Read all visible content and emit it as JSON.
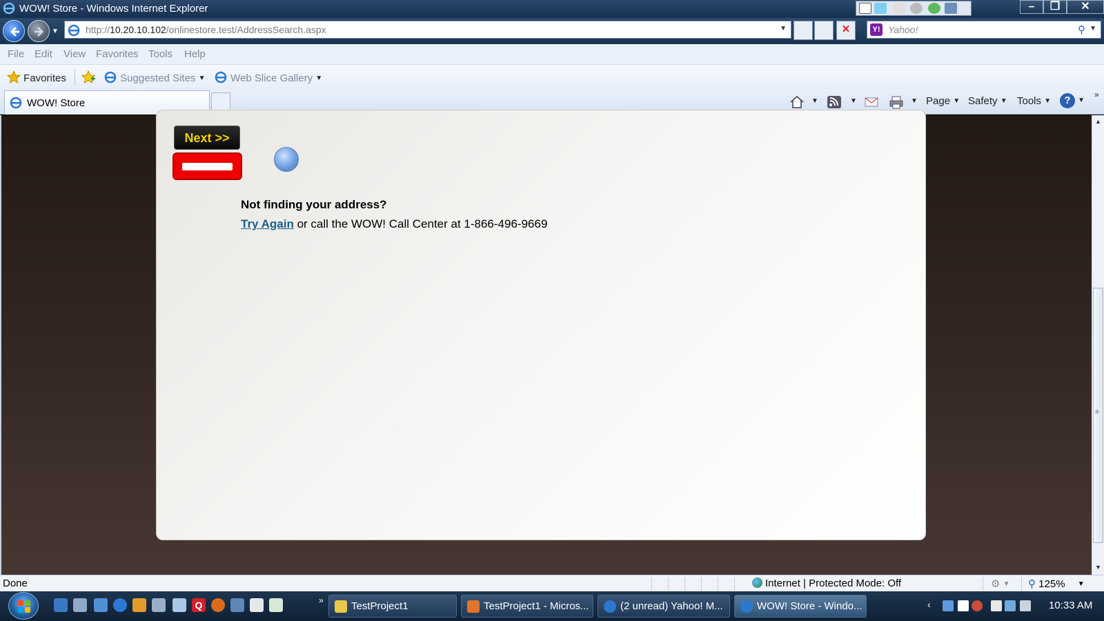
{
  "window": {
    "title": "WOW! Store - Windows Internet Explorer"
  },
  "address_bar": {
    "url_prefix": "http://",
    "url_host": "10.20.10.102",
    "url_path": "/onlinestore.test/AddressSearch.aspx"
  },
  "search": {
    "placeholder": "Yahoo!",
    "logo_letter": "Y!"
  },
  "menu": [
    "File",
    "Edit",
    "View",
    "Favorites",
    "Tools",
    "Help"
  ],
  "favorites_bar": {
    "favorites_label": "Favorites",
    "suggested_label": "Suggested Sites",
    "webslice_label": "Web Slice Gallery"
  },
  "tabs": [
    {
      "label": "WOW! Store"
    }
  ],
  "command_bar": {
    "page_label": "Page",
    "safety_label": "Safety",
    "tools_label": "Tools",
    "help_label": "?"
  },
  "page": {
    "next_button": "Next >>",
    "not_finding": "Not finding your address?",
    "try_again": "Try Again",
    "call_text": " or call the WOW! Call Center at 1-866-496-9669"
  },
  "status_bar": {
    "status": "Done",
    "zone": "Internet | Protected Mode: Off",
    "zoom": "125%"
  },
  "taskbar": {
    "tasks": [
      {
        "label": "TestProject1"
      },
      {
        "label": "TestProject1 - Micros..."
      },
      {
        "label": "(2 unread) Yahoo! M..."
      },
      {
        "label": "WOW! Store - Windo..."
      }
    ],
    "clock": "10:33 AM"
  },
  "colors": {
    "next_text": "#f5d200",
    "red_button": "#ee0000",
    "link": "#1b5d8a"
  }
}
